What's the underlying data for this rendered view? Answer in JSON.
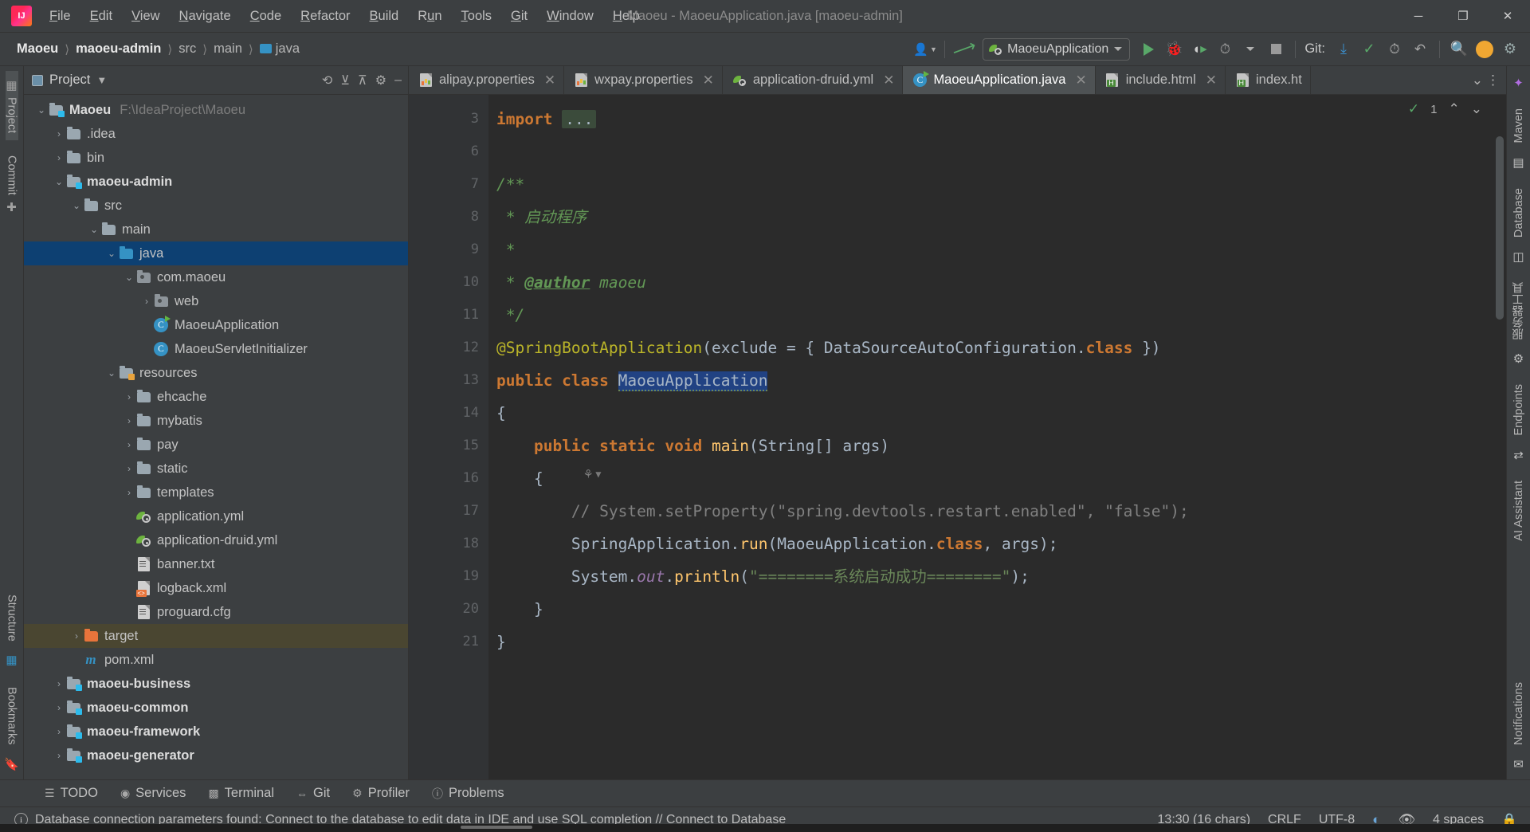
{
  "window": {
    "title": "Maoeu - MaoeuApplication.java [maoeu-admin]",
    "minimize": "─",
    "maximize": "❐",
    "close": "✕"
  },
  "menu": {
    "items": [
      "File",
      "Edit",
      "View",
      "Navigate",
      "Code",
      "Refactor",
      "Build",
      "Run",
      "Tools",
      "Git",
      "Window",
      "Help"
    ]
  },
  "breadcrumbs": {
    "items": [
      {
        "label": "Maoeu",
        "style": "bold"
      },
      {
        "label": "maoeu-admin",
        "style": "bold"
      },
      {
        "label": "src",
        "style": "dim"
      },
      {
        "label": "main",
        "style": "dim"
      },
      {
        "label": "java",
        "style": "dim-folder"
      }
    ],
    "separator": "〉"
  },
  "toolbar": {
    "user_icon": "user-profile-icon",
    "update_icon": "update-project-icon",
    "run_config": "MaoeuApplication",
    "run_label": "Run",
    "debug_label": "Debug",
    "run_coverage_label": "Run with Coverage",
    "profiler_label": "Profiler",
    "stop_label": "Stop",
    "git_label": "Git:",
    "search_label": "Search Everywhere",
    "avatar_initial": "",
    "settings_label": "Settings"
  },
  "project_panel": {
    "title": "Project",
    "tree": [
      {
        "depth": 0,
        "arrow": "⌄",
        "icon": "module-folder",
        "label": "Maoeu",
        "bold": true,
        "path": "F:\\IdeaProject\\Maoeu"
      },
      {
        "depth": 1,
        "arrow": "›",
        "icon": "folder",
        "label": ".idea",
        "bold": false,
        "path": ""
      },
      {
        "depth": 1,
        "arrow": "›",
        "icon": "folder",
        "label": "bin",
        "bold": false,
        "path": ""
      },
      {
        "depth": 1,
        "arrow": "⌄",
        "icon": "module-folder",
        "label": "maoeu-admin",
        "bold": true,
        "path": ""
      },
      {
        "depth": 2,
        "arrow": "⌄",
        "icon": "folder",
        "label": "src",
        "bold": false,
        "path": ""
      },
      {
        "depth": 3,
        "arrow": "⌄",
        "icon": "folder",
        "label": "main",
        "bold": false,
        "path": ""
      },
      {
        "depth": 4,
        "arrow": "⌄",
        "icon": "source-folder",
        "label": "java",
        "bold": false,
        "path": "",
        "selected": true
      },
      {
        "depth": 5,
        "arrow": "⌄",
        "icon": "package",
        "label": "com.maoeu",
        "bold": false,
        "path": ""
      },
      {
        "depth": 6,
        "arrow": "›",
        "icon": "package",
        "label": "web",
        "bold": false,
        "path": ""
      },
      {
        "depth": 6,
        "arrow": "",
        "icon": "class-runnable",
        "label": "MaoeuApplication",
        "bold": false,
        "path": ""
      },
      {
        "depth": 6,
        "arrow": "",
        "icon": "class",
        "label": "MaoeuServletInitializer",
        "bold": false,
        "path": ""
      },
      {
        "depth": 4,
        "arrow": "⌄",
        "icon": "resource-folder",
        "label": "resources",
        "bold": false,
        "path": ""
      },
      {
        "depth": 5,
        "arrow": "›",
        "icon": "folder",
        "label": "ehcache",
        "bold": false,
        "path": ""
      },
      {
        "depth": 5,
        "arrow": "›",
        "icon": "folder",
        "label": "mybatis",
        "bold": false,
        "path": ""
      },
      {
        "depth": 5,
        "arrow": "›",
        "icon": "folder",
        "label": "pay",
        "bold": false,
        "path": ""
      },
      {
        "depth": 5,
        "arrow": "›",
        "icon": "folder",
        "label": "static",
        "bold": false,
        "path": ""
      },
      {
        "depth": 5,
        "arrow": "›",
        "icon": "folder",
        "label": "templates",
        "bold": false,
        "path": ""
      },
      {
        "depth": 5,
        "arrow": "",
        "icon": "spring-yaml",
        "label": "application.yml",
        "bold": false,
        "path": ""
      },
      {
        "depth": 5,
        "arrow": "",
        "icon": "spring-yaml",
        "label": "application-druid.yml",
        "bold": false,
        "path": ""
      },
      {
        "depth": 5,
        "arrow": "",
        "icon": "text-file",
        "label": "banner.txt",
        "bold": false,
        "path": ""
      },
      {
        "depth": 5,
        "arrow": "",
        "icon": "xml-file",
        "label": "logback.xml",
        "bold": false,
        "path": ""
      },
      {
        "depth": 5,
        "arrow": "",
        "icon": "cfg-file",
        "label": "proguard.cfg",
        "bold": false,
        "path": ""
      },
      {
        "depth": 2,
        "arrow": "›",
        "icon": "target-folder",
        "label": "target",
        "bold": false,
        "path": "",
        "target": true
      },
      {
        "depth": 2,
        "arrow": "",
        "icon": "maven-file",
        "label": "pom.xml",
        "bold": false,
        "path": ""
      },
      {
        "depth": 1,
        "arrow": "›",
        "icon": "module-folder",
        "label": "maoeu-business",
        "bold": true,
        "path": ""
      },
      {
        "depth": 1,
        "arrow": "›",
        "icon": "module-folder",
        "label": "maoeu-common",
        "bold": true,
        "path": ""
      },
      {
        "depth": 1,
        "arrow": "›",
        "icon": "module-folder",
        "label": "maoeu-framework",
        "bold": true,
        "path": ""
      },
      {
        "depth": 1,
        "arrow": "›",
        "icon": "module-folder",
        "label": "maoeu-generator",
        "bold": true,
        "path": ""
      }
    ]
  },
  "left_rail": {
    "items": [
      {
        "label": "Project",
        "icon": "project-icon",
        "active": true
      },
      {
        "label": "Commit",
        "icon": "commit-icon",
        "active": false
      },
      {
        "label": "Structure",
        "icon": "structure-icon",
        "active": false
      },
      {
        "label": "Bookmarks",
        "icon": "bookmarks-icon",
        "active": false
      }
    ]
  },
  "right_rail": {
    "items": [
      {
        "label": "Maven",
        "icon": "maven-icon"
      },
      {
        "label": "Database",
        "icon": "database-icon"
      },
      {
        "label": "服务器工具",
        "icon": "server-tools-icon"
      },
      {
        "label": "Endpoints",
        "icon": "endpoints-icon"
      },
      {
        "label": "AI Assistant",
        "icon": "ai-assistant-icon"
      },
      {
        "label": "Notifications",
        "icon": "notifications-icon"
      }
    ]
  },
  "tabs": {
    "items": [
      {
        "label": "alipay.properties",
        "icon": "properties-icon",
        "active": false
      },
      {
        "label": "wxpay.properties",
        "icon": "properties-icon",
        "active": false
      },
      {
        "label": "application-druid.yml",
        "icon": "spring-yaml-icon",
        "active": false
      },
      {
        "label": "MaoeuApplication.java",
        "icon": "spring-class-icon",
        "active": true
      },
      {
        "label": "include.html",
        "icon": "html-icon",
        "active": false
      },
      {
        "label": "index.ht",
        "icon": "html-icon",
        "active": false
      }
    ],
    "overflow": "⌄",
    "more": "⋮"
  },
  "editor": {
    "inspection_count": "1",
    "inspection_icon": "inspection-check-icon",
    "up_arrow": "⌃",
    "down_arrow": "⌄",
    "inlay_hint": "implementations-inlay",
    "lines": [
      {
        "num": "3",
        "fold": "⊞",
        "html": "<span class=\"kw\">import</span> <span class=\"imp-fold\">...</span>"
      },
      {
        "num": "6",
        "fold": "",
        "html": ""
      },
      {
        "num": "7",
        "fold": "⊟",
        "html": "<span class=\"jdoc\">/**</span>"
      },
      {
        "num": "8",
        "fold": "",
        "html": "<span class=\"jdoc\"> * 启动程序</span>"
      },
      {
        "num": "9",
        "fold": "",
        "html": "<span class=\"jdoc\"> *</span>"
      },
      {
        "num": "10",
        "fold": "",
        "html": "<span class=\"jdoc\"> * <span class=\"jdoc-tag\">@author</span> maoeu</span>"
      },
      {
        "num": "11",
        "fold": "⌐",
        "html": "<span class=\"jdoc\"> */</span>"
      },
      {
        "num": "12",
        "fold": "",
        "gutter_icon": "spring-bean",
        "html": "<span class=\"ann\">@SpringBootApplication</span><span class=\"type\">(exclude = { DataSourceAutoConfiguration.</span><span class=\"kw\">class</span><span class=\"type\"> })</span>"
      },
      {
        "num": "13",
        "fold": "",
        "gutter_icon": "run",
        "html": "<span class=\"kw\">public class</span> <span class=\"sel-tok squig\">MaoeuApplication</span>"
      },
      {
        "num": "14",
        "fold": "",
        "html": "<span class=\"type\">{</span>"
      },
      {
        "num": "15",
        "fold": "",
        "gutter_icon": "run",
        "html": "    <span class=\"kw\">public static void</span> <span class=\"mth\">main</span><span class=\"type\">(String[] args)</span>"
      },
      {
        "num": "16",
        "fold": "⊟",
        "html": "    <span class=\"type\">{</span>"
      },
      {
        "num": "17",
        "fold": "",
        "html": "        <span class=\"cmt\">// System.setProperty(\"spring.devtools.restart.enabled\", \"false\");</span>"
      },
      {
        "num": "18",
        "fold": "",
        "html": "        <span class=\"type\">SpringApplication.</span><span class=\"mth\">run</span><span class=\"type\">(MaoeuApplication.</span><span class=\"kw\">class</span><span class=\"type\">, args);</span>"
      },
      {
        "num": "19",
        "fold": "",
        "html": "        <span class=\"type\">System.</span><span class=\"fld\">out</span><span class=\"type\">.</span><span class=\"mth\">println</span><span class=\"type\">(</span><span class=\"str\">\"========系统启动成功========\"</span><span class=\"type\">);</span>"
      },
      {
        "num": "20",
        "fold": "⌐",
        "html": "    <span class=\"type\">}</span>"
      },
      {
        "num": "21",
        "fold": "",
        "html": "<span class=\"type\">}</span>"
      }
    ]
  },
  "tool_windows": {
    "items": [
      {
        "label": "TODO",
        "icon": "todo-icon"
      },
      {
        "label": "Services",
        "icon": "services-icon"
      },
      {
        "label": "Terminal",
        "icon": "terminal-icon"
      },
      {
        "label": "Git",
        "icon": "git-icon"
      },
      {
        "label": "Profiler",
        "icon": "profiler-icon"
      },
      {
        "label": "Problems",
        "icon": "problems-icon"
      }
    ]
  },
  "statusbar": {
    "message": "Database connection parameters found: Connect to the database to edit data in IDE and use SQL completion // Connect to Database",
    "info_icon": "info-icon",
    "caret": "13:30 (16 chars)",
    "line_sep": "CRLF",
    "encoding": "UTF-8",
    "translate_icon": "translate-icon",
    "inspection_icon": "inspection-eye-icon",
    "indent": "4 spaces",
    "lock_icon": "lock-icon"
  },
  "colors": {
    "bg": "#3c3f41",
    "editor_bg": "#2b2b2b",
    "gutter_bg": "#313335",
    "selection": "#0d4072",
    "accent_green": "#59a869",
    "accent_blue": "#3592c4",
    "orange": "#e8743b",
    "token_selection": "#214283"
  }
}
